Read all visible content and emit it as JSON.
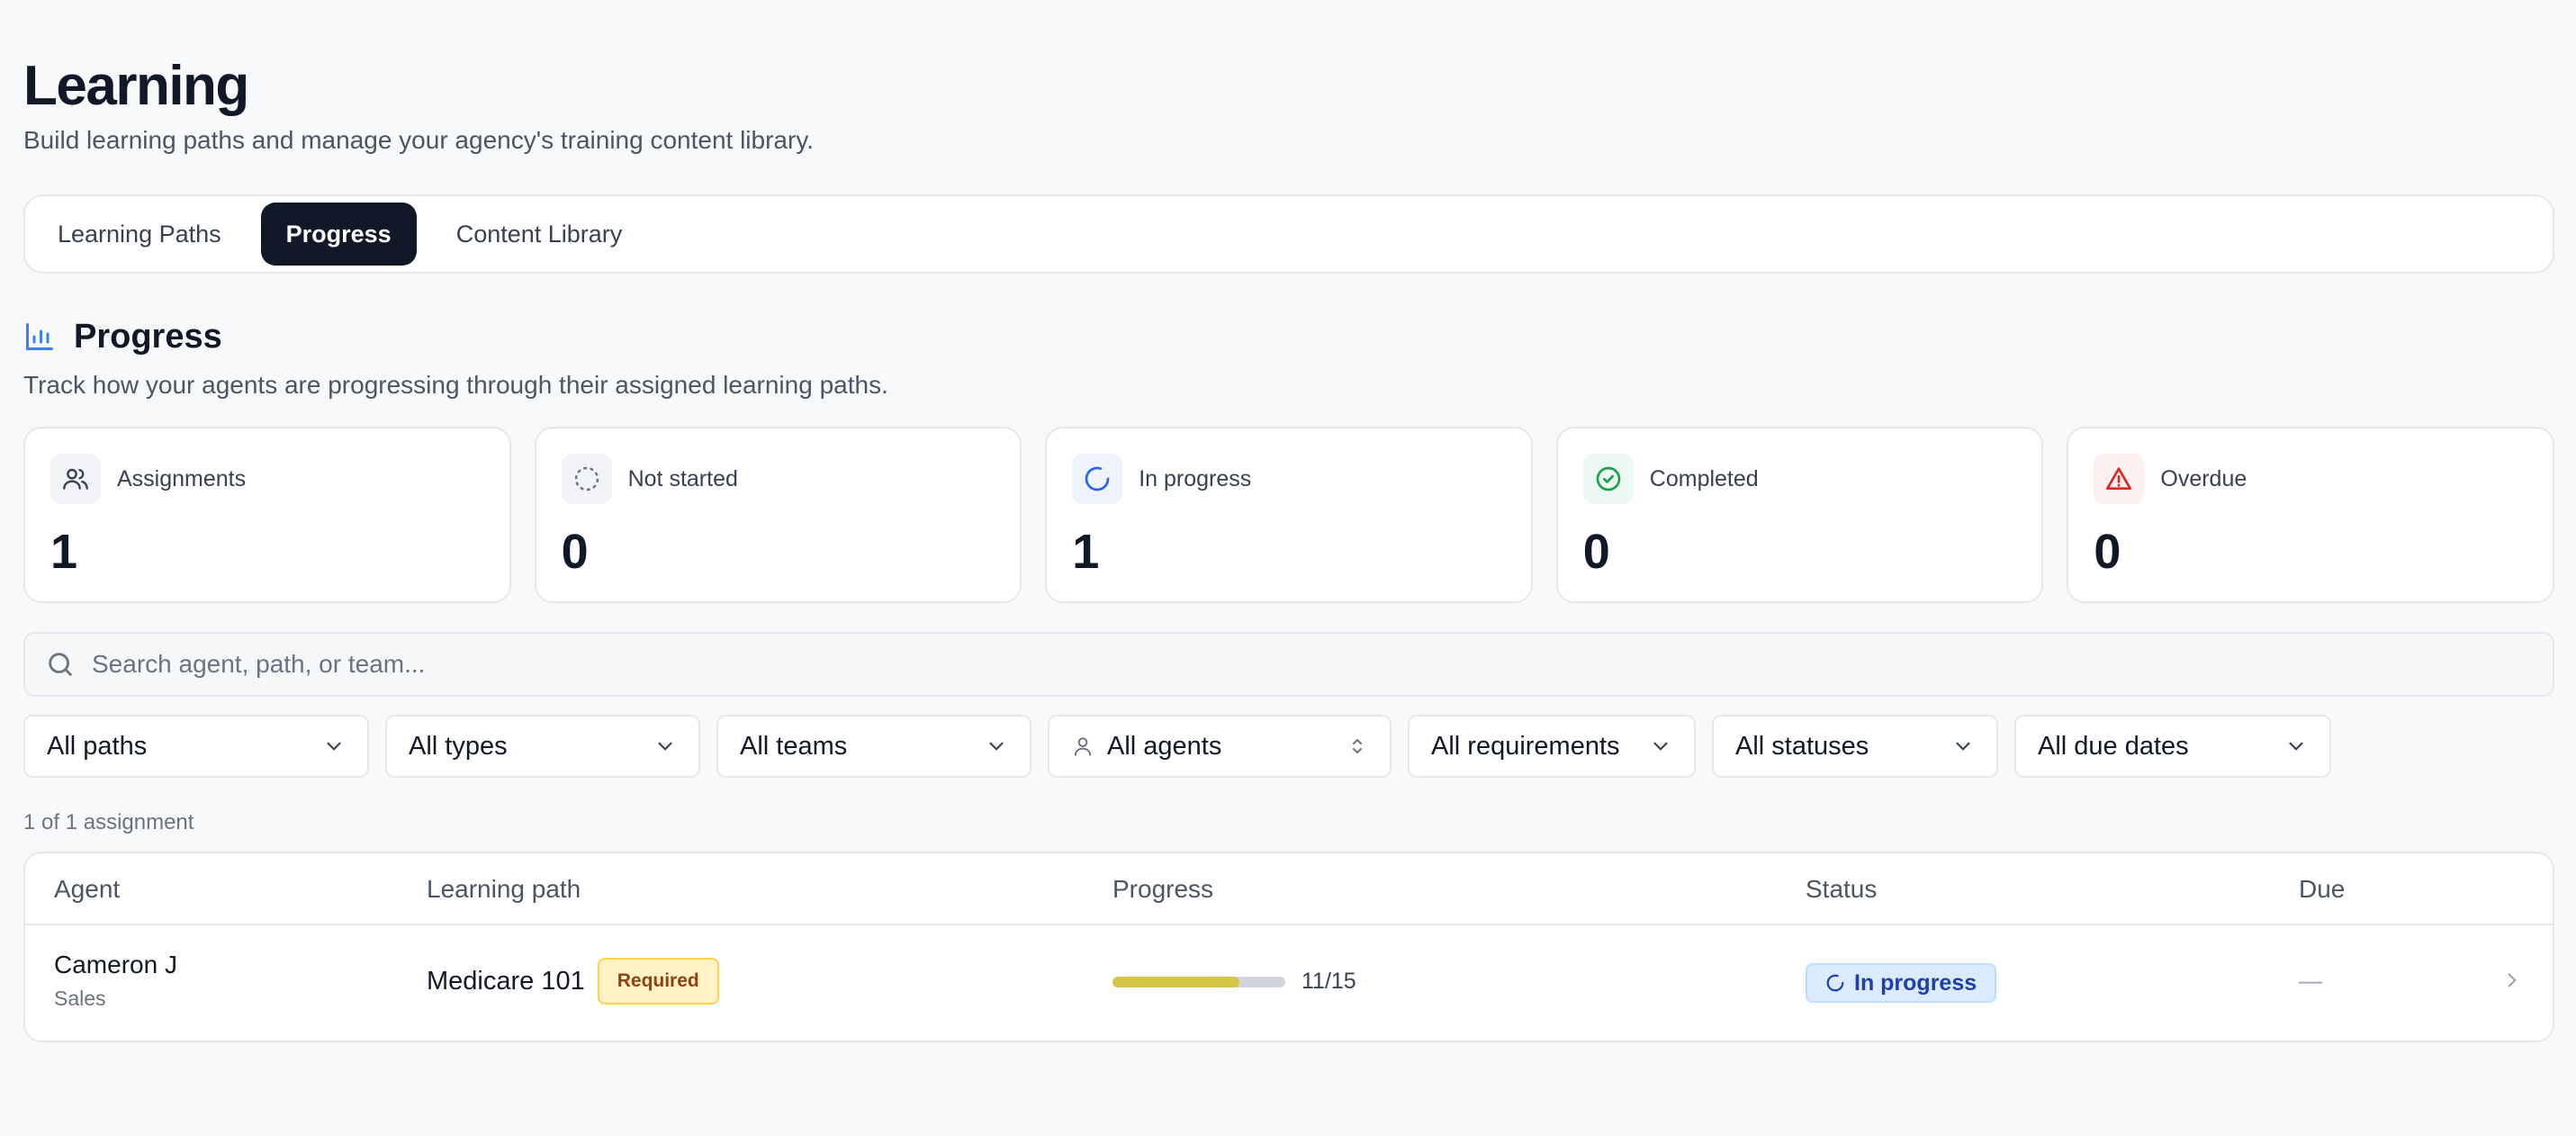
{
  "header": {
    "title": "Learning",
    "subtitle": "Build learning paths and manage your agency's training content library."
  },
  "tabs": [
    {
      "label": "Learning Paths",
      "active": false
    },
    {
      "label": "Progress",
      "active": true
    },
    {
      "label": "Content Library",
      "active": false
    }
  ],
  "section": {
    "icon": "bar-chart-icon",
    "title": "Progress",
    "subtitle": "Track how your agents are progressing through their assigned learning paths."
  },
  "stats": [
    {
      "icon": "users-icon",
      "label": "Assignments",
      "value": "1"
    },
    {
      "icon": "dashed-circle-icon",
      "label": "Not started",
      "value": "0"
    },
    {
      "icon": "spinner-icon",
      "label": "In progress",
      "value": "1"
    },
    {
      "icon": "check-circle-icon",
      "label": "Completed",
      "value": "0"
    },
    {
      "icon": "warning-triangle-icon",
      "label": "Overdue",
      "value": "0"
    }
  ],
  "search": {
    "placeholder": "Search agent, path, or team..."
  },
  "filters": [
    {
      "label": "All paths"
    },
    {
      "label": "All types"
    },
    {
      "label": "All teams"
    },
    {
      "label": "All agents"
    },
    {
      "label": "All requirements"
    },
    {
      "label": "All statuses"
    },
    {
      "label": "All due dates"
    }
  ],
  "result_count": "1 of 1 assignment",
  "table": {
    "columns": [
      "Agent",
      "Learning path",
      "Progress",
      "Status",
      "Due"
    ],
    "rows": [
      {
        "agent": "Cameron J",
        "team": "Sales",
        "path": "Medicare 101",
        "requirement": "Required",
        "progress_done": 11,
        "progress_total": 15,
        "progress_text": "11/15",
        "status": "In progress",
        "due": "—"
      }
    ]
  },
  "colors": {
    "accent_dark": "#111827",
    "progress_fill": "#d4c645",
    "status_in_progress": "#1e40af",
    "required_badge": "#92400e"
  }
}
